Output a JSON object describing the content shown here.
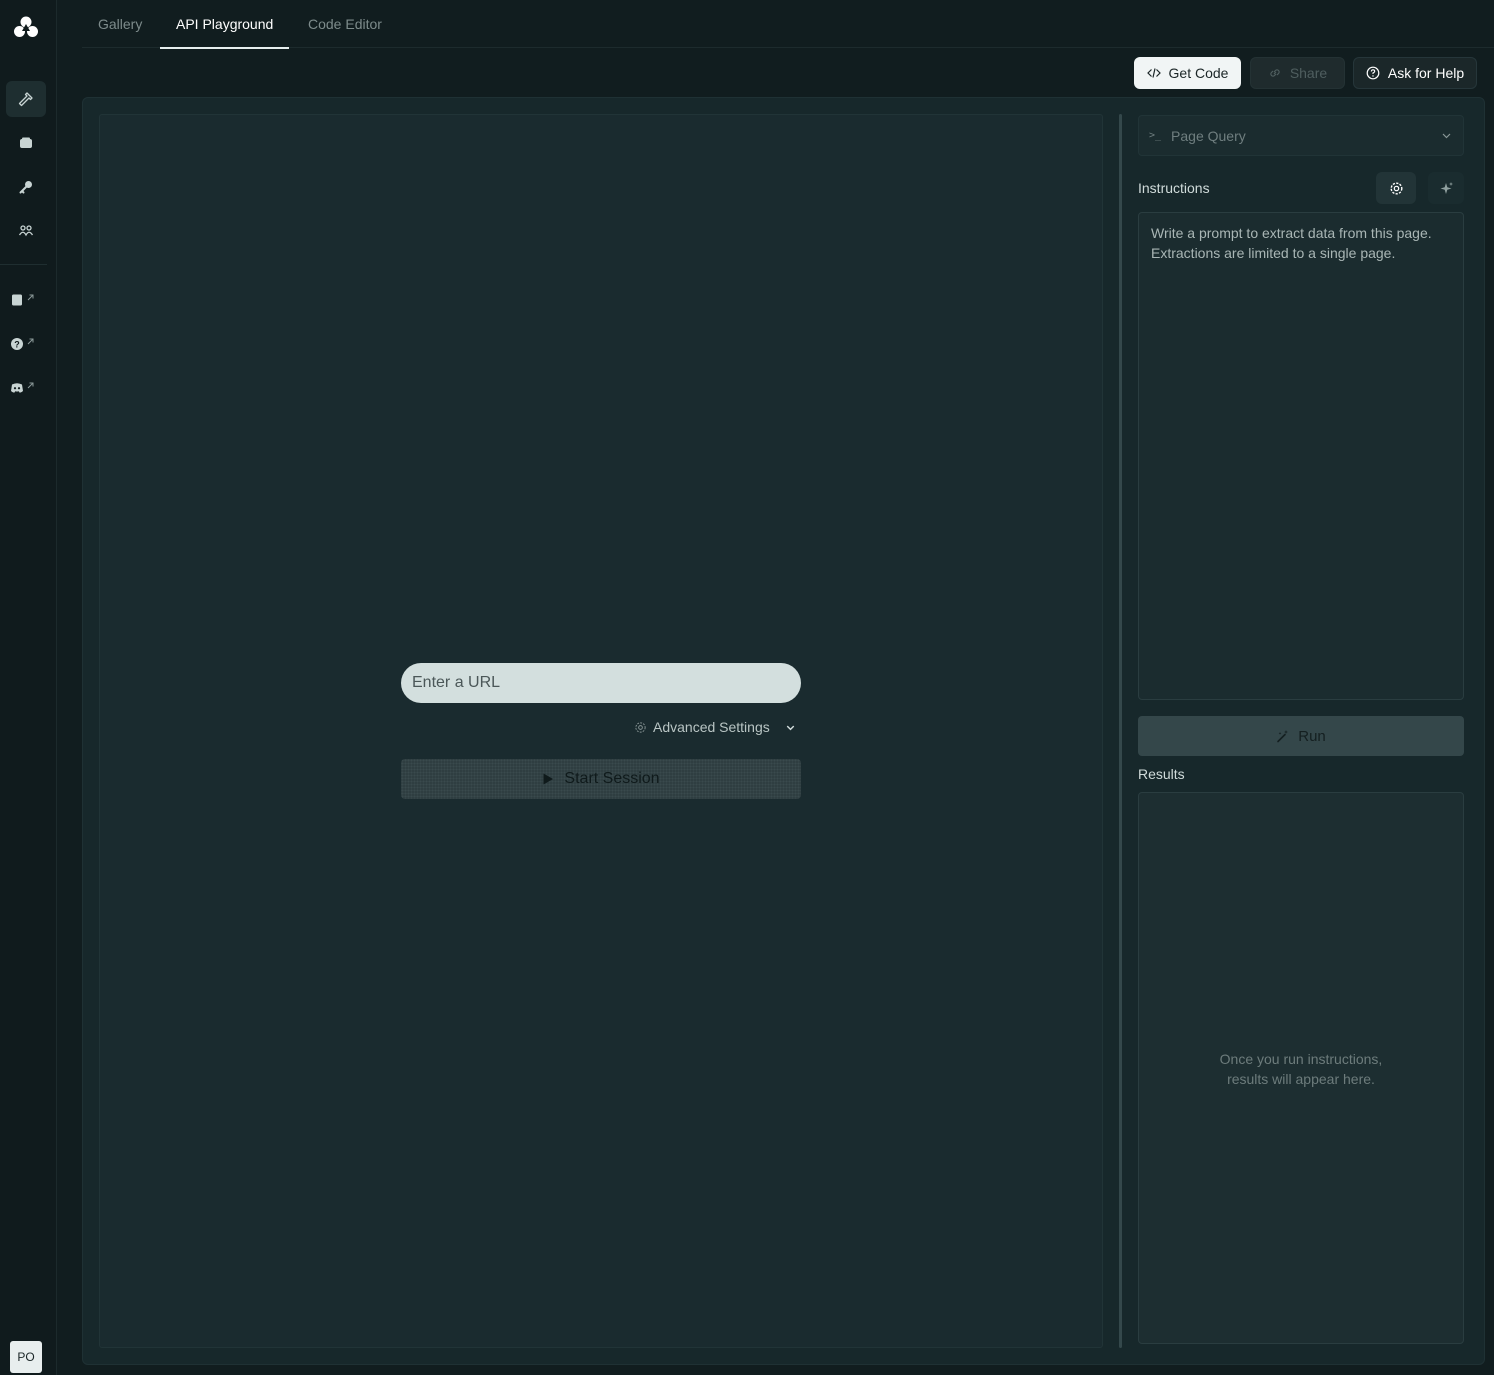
{
  "app": {
    "avatar_initials": "PO"
  },
  "sidebar": {
    "primary": [
      {
        "name": "build",
        "icon": "hammer-icon",
        "active": true
      },
      {
        "name": "sessions",
        "icon": "box-icon",
        "active": false
      },
      {
        "name": "api-keys",
        "icon": "key-icon",
        "active": false
      },
      {
        "name": "team",
        "icon": "users-icon",
        "active": false
      }
    ],
    "external": [
      {
        "name": "docs",
        "icon": "book-icon"
      },
      {
        "name": "help",
        "icon": "question-circle-icon"
      },
      {
        "name": "discord",
        "icon": "discord-icon"
      }
    ]
  },
  "tabs": [
    {
      "label": "Gallery",
      "active": false
    },
    {
      "label": "API Playground",
      "active": true
    },
    {
      "label": "Code Editor",
      "active": false
    }
  ],
  "toolbar": {
    "get_code": "Get Code",
    "share": "Share",
    "ask_for_help": "Ask for Help"
  },
  "session": {
    "url_placeholder": "Enter a URL",
    "advanced_settings": "Advanced Settings",
    "start_session": "Start Session"
  },
  "query": {
    "mode": "Page Query",
    "instructions_label": "Instructions",
    "instructions_placeholder": "Write a prompt to extract data from this page. Extractions are limited to a single page.",
    "run": "Run",
    "results_label": "Results",
    "results_empty_line1": "Once you run instructions,",
    "results_empty_line2": "results will appear here."
  },
  "colors": {
    "background": "#111d1f",
    "panel": "#17282b",
    "accent_light": "#f1f5f5"
  }
}
